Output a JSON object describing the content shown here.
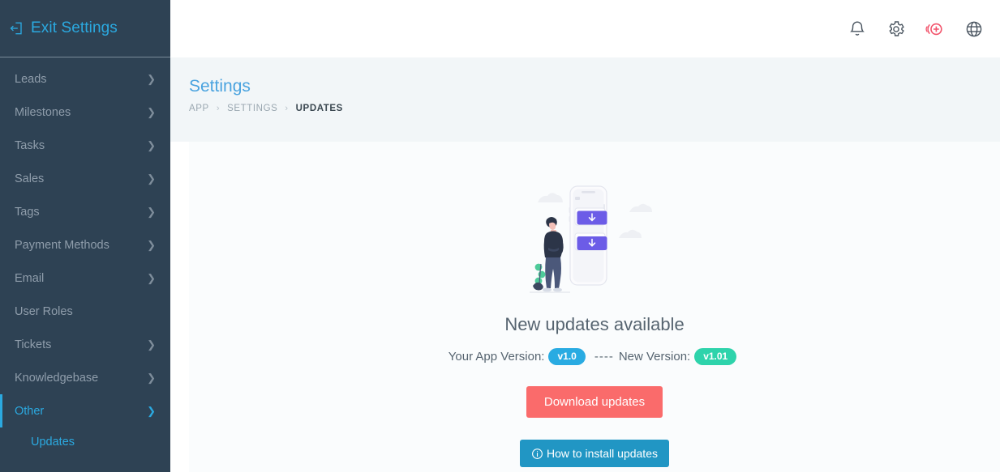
{
  "sidebar": {
    "exit": {
      "label": "Exit Settings",
      "icon": "exit-icon"
    },
    "items": [
      {
        "label": "Leads",
        "icon": "chevron-right-icon",
        "has_chevron": true,
        "active": false
      },
      {
        "label": "Milestones",
        "icon": "chevron-right-icon",
        "has_chevron": true,
        "active": false
      },
      {
        "label": "Tasks",
        "icon": "chevron-right-icon",
        "has_chevron": true,
        "active": false
      },
      {
        "label": "Sales",
        "icon": "chevron-right-icon",
        "has_chevron": true,
        "active": false
      },
      {
        "label": "Tags",
        "icon": "chevron-right-icon",
        "has_chevron": true,
        "active": false
      },
      {
        "label": "Payment Methods",
        "icon": "chevron-right-icon",
        "has_chevron": true,
        "active": false
      },
      {
        "label": "Email",
        "icon": "chevron-right-icon",
        "has_chevron": true,
        "active": false
      },
      {
        "label": "User Roles",
        "icon": "",
        "has_chevron": false,
        "active": false
      },
      {
        "label": "Tickets",
        "icon": "chevron-right-icon",
        "has_chevron": true,
        "active": false
      },
      {
        "label": "Knowledgebase",
        "icon": "chevron-right-icon",
        "has_chevron": true,
        "active": false
      },
      {
        "label": "Other",
        "icon": "chevron-down-icon",
        "has_chevron": true,
        "active": true
      }
    ],
    "sub_item": {
      "label": "Updates",
      "active": true
    }
  },
  "topbar": {
    "icons": [
      {
        "name": "bell-icon",
        "title": "Notifications"
      },
      {
        "name": "gear-icon",
        "title": "Settings"
      },
      {
        "name": "add-circle-icon",
        "title": "Add"
      },
      {
        "name": "globe-icon",
        "title": "Language"
      }
    ]
  },
  "header": {
    "title": "Settings",
    "breadcrumb": [
      "APP",
      "SETTINGS",
      "UPDATES"
    ],
    "separator": "›"
  },
  "content": {
    "illustration_name": "updates-illustration",
    "heading": "New updates available",
    "your_version_label": "Your App Version:",
    "your_version": "v1.0",
    "dashes": "----",
    "new_version_label": "New Version:",
    "new_version": "v1.01",
    "download_button": "Download updates",
    "howto_button": "How to install updates"
  },
  "colors": {
    "sidebar_bg": "#2e4254",
    "accent_cyan": "#2ba9e0",
    "title_blue": "#4aa3df",
    "badge_blue": "#29abe2",
    "badge_teal": "#2ed3ab",
    "download_red": "#fa6b6b",
    "howto_blue": "#2196c4",
    "add_icon_red": "#f2536b",
    "illustration_purple": "#6c5ce7"
  }
}
